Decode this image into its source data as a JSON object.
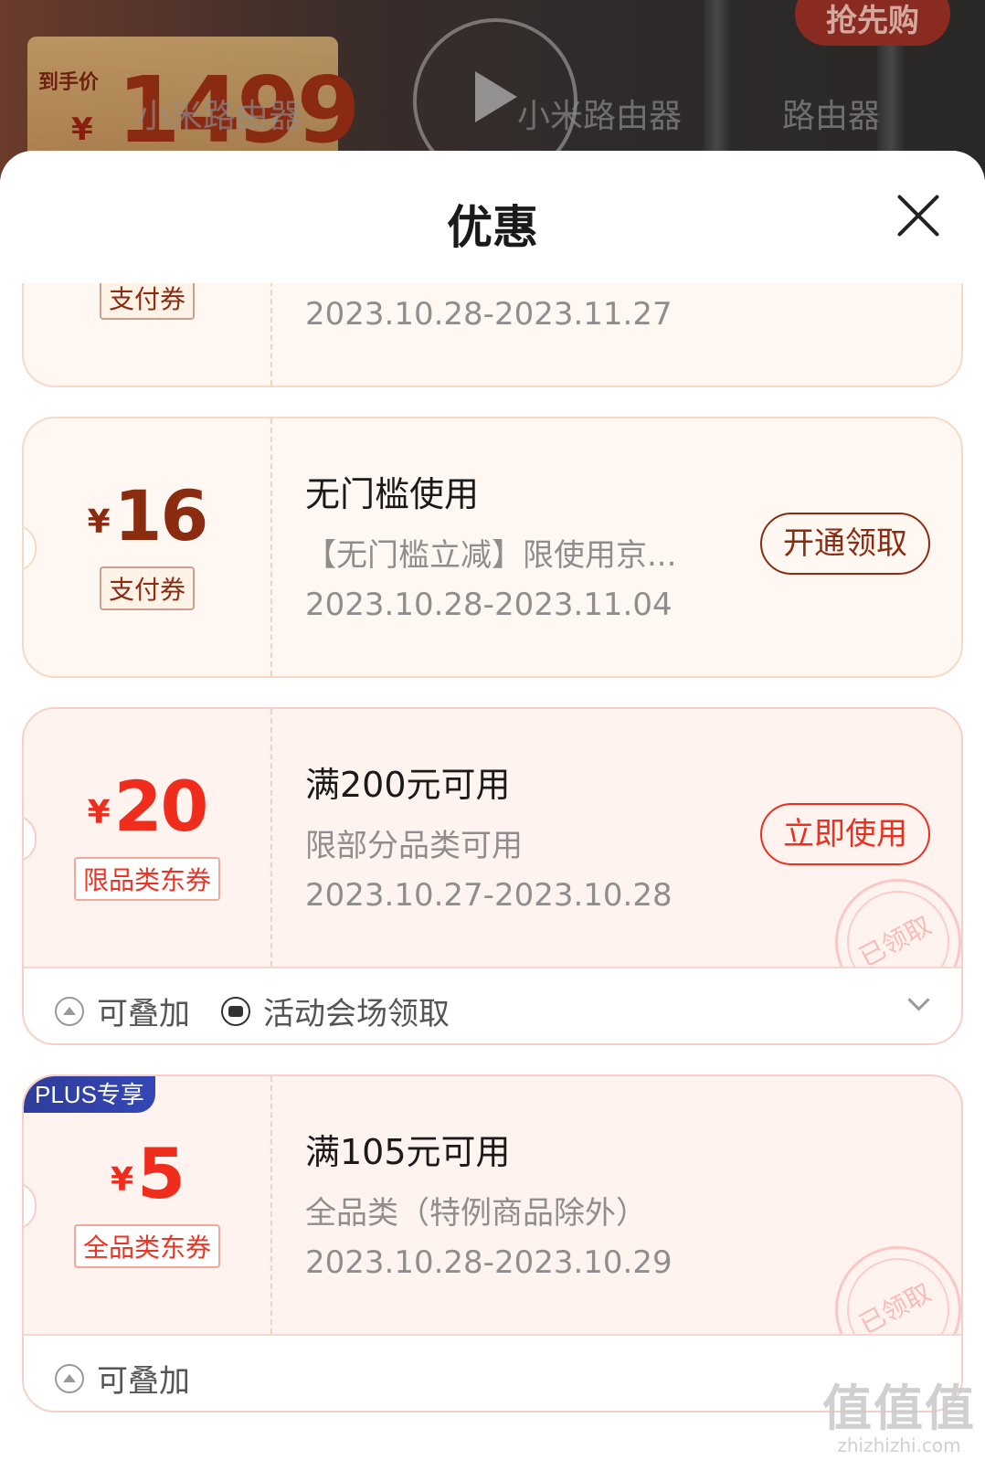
{
  "background": {
    "price_label": "到手价",
    "yen": "¥",
    "price": "1499",
    "rush_button": "抢先购",
    "ghost_texts": [
      "小米路由器",
      "小米路由器",
      "路由器"
    ]
  },
  "sheet": {
    "title": "优惠",
    "close_icon": "close-icon"
  },
  "coupons": [
    {
      "tag": "支付券",
      "date": "2023.10.28-2023.11.27"
    },
    {
      "yen": "¥",
      "amount": "16",
      "tag": "支付券",
      "title": "无门槛使用",
      "desc": "【无门槛立减】限使用京...",
      "date": "2023.10.28-2023.11.04",
      "button": "开通领取"
    },
    {
      "yen": "¥",
      "amount": "20",
      "tag": "限品类东券",
      "title": "满200元可用",
      "desc": "限部分品类可用",
      "date": "2023.10.27-2023.10.28",
      "button": "立即使用",
      "stamp": "已领取",
      "footer": {
        "stackable": "可叠加",
        "source": "活动会场领取"
      }
    },
    {
      "badge": "PLUS专享",
      "yen": "¥",
      "amount": "5",
      "tag": "全品类东券",
      "title": "满105元可用",
      "desc": "全品类（特例商品除外）",
      "date": "2023.10.28-2023.10.29",
      "stamp": "已领取",
      "footer": {
        "stackable": "可叠加"
      }
    }
  ],
  "watermark": {
    "big": "值值值",
    "small": "zhizhizhi.com"
  },
  "colors": {
    "brown": "#8b2b10",
    "red": "#f02d1c",
    "plus_blue": "#2f3d9a"
  }
}
